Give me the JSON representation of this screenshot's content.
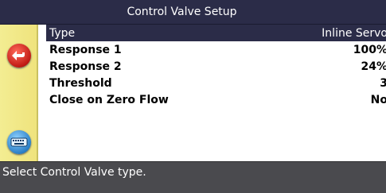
{
  "window": {
    "title": "Control Valve Setup"
  },
  "sidebar": {
    "back_icon": "back-arrow-icon",
    "keypad_icon": "keypad-icon"
  },
  "settings": [
    {
      "label": "Type",
      "value": "Inline Servo",
      "selected": true
    },
    {
      "label": "Response 1",
      "value": "100%"
    },
    {
      "label": "Response 2",
      "value": "24%"
    },
    {
      "label": "Threshold",
      "value": "3"
    },
    {
      "label": "Close on Zero Flow",
      "value": "No"
    }
  ],
  "status": {
    "message": "Select Control Valve type."
  },
  "colors": {
    "title_bg": "#2b2c48",
    "selected_bg": "#2b2c48",
    "sidebar_bg": "#f3ed92",
    "status_bg": "#4a4a4e",
    "back_button": "#c11a14",
    "keypad_button": "#2b7fc7"
  }
}
